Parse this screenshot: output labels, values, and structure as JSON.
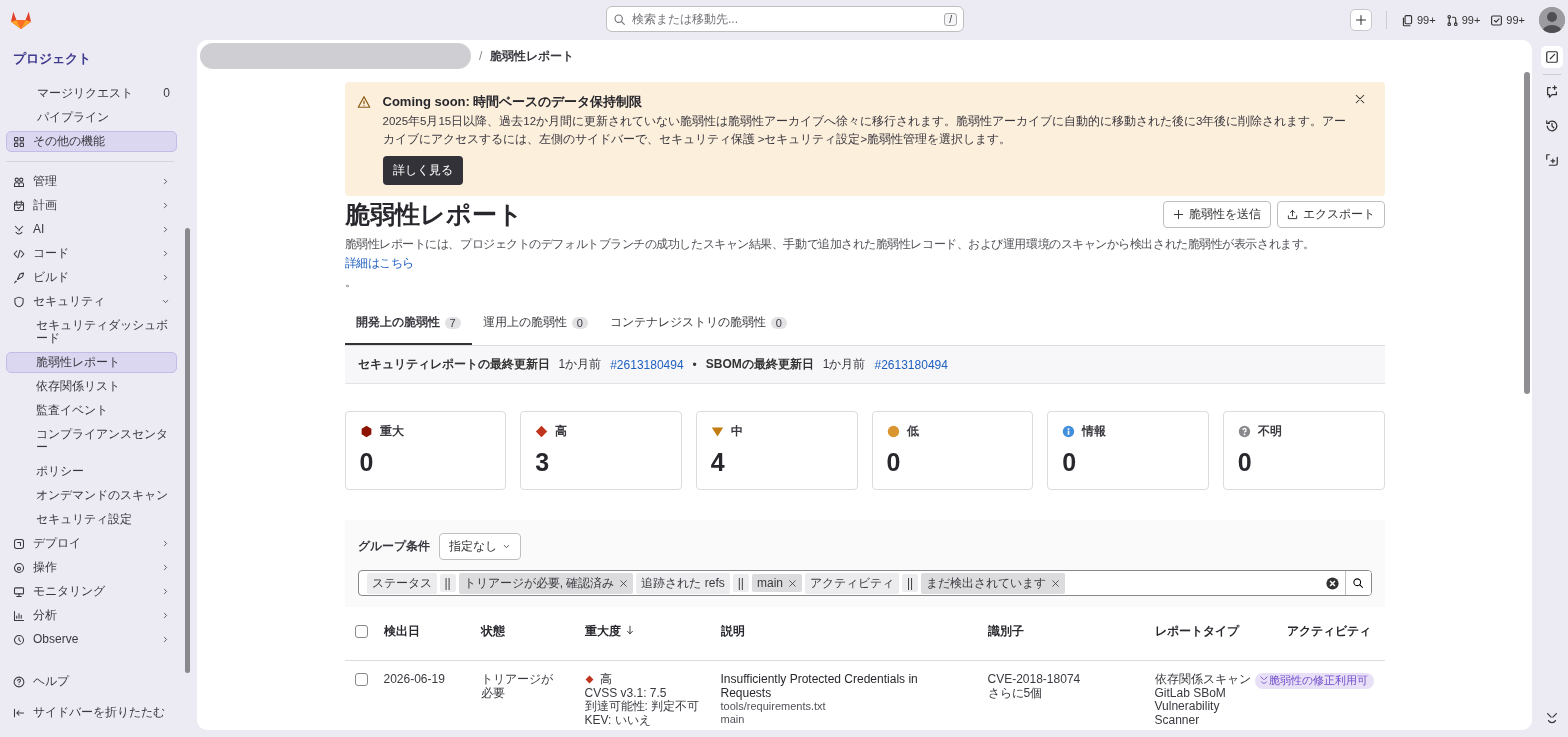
{
  "topbar": {
    "search_placeholder": "検索または移動先...",
    "shortcut": "/",
    "counters": [
      {
        "kind": "issues",
        "value": "99+"
      },
      {
        "kind": "merge-requests",
        "value": "99+"
      },
      {
        "kind": "todos",
        "value": "99+"
      }
    ]
  },
  "sidebar": {
    "title": "プロジェクト",
    "pinned": [
      {
        "label": "マージリクエスト",
        "count": "0",
        "selected": false
      },
      {
        "label": "パイプライン",
        "selected": false
      },
      {
        "label": "その他の機能",
        "selected": true
      }
    ],
    "groups": [
      {
        "label": "管理",
        "expanded": false
      },
      {
        "label": "計画",
        "expanded": false
      },
      {
        "label": "AI",
        "expanded": false
      },
      {
        "label": "コード",
        "expanded": false
      },
      {
        "label": "ビルド",
        "expanded": false
      },
      {
        "label": "セキュリティ",
        "expanded": true,
        "children": [
          {
            "label": "セキュリティダッシュボード",
            "selected": false
          },
          {
            "label": "脆弱性レポート",
            "selected": true
          },
          {
            "label": "依存関係リスト",
            "selected": false
          },
          {
            "label": "監査イベント",
            "selected": false
          },
          {
            "label": "コンプライアンスセンター",
            "selected": false
          },
          {
            "label": "ポリシー",
            "selected": false
          },
          {
            "label": "オンデマンドのスキャン",
            "selected": false
          },
          {
            "label": "セキュリティ設定",
            "selected": false
          }
        ]
      },
      {
        "label": "デプロイ",
        "expanded": false
      },
      {
        "label": "操作",
        "expanded": false
      },
      {
        "label": "モニタリング",
        "expanded": false
      },
      {
        "label": "分析",
        "expanded": false
      },
      {
        "label": "Observe",
        "expanded": false
      }
    ],
    "footer": [
      "ヘルプ",
      "サイドバーを折りたたむ"
    ]
  },
  "breadcrumb": {
    "separator": "/",
    "current": "脆弱性レポート"
  },
  "banner": {
    "title": "Coming soon: 時間ベースのデータ保持制限",
    "text": "2025年5月15日以降、過去12か月間に更新されていない脆弱性は脆弱性アーカイブへ徐々に移行されます。脆弱性アーカイブに自動的に移動された後に3年後に削除されます。アーカイブにアクセスするには、左側のサイドバーで、セキュリティ保護 >セキュリティ設定>脆弱性管理を選択します。",
    "button": "詳しく見る"
  },
  "page": {
    "title": "脆弱性レポート",
    "buttons": [
      {
        "kind": "add",
        "label": "脆弱性を送信"
      },
      {
        "kind": "export",
        "label": "エクスポート"
      }
    ],
    "description": "脆弱性レポートには、プロジェクトのデフォルトブランチの成功したスキャン結果、手動で追加された脆弱性レコード、および運用環境のスキャンから検出された脆弱性が表示されます。",
    "link": "詳細はこちら",
    "suffix": "。"
  },
  "tabs": [
    {
      "label": "開発上の脆弱性",
      "count": "7",
      "selected": true
    },
    {
      "label": "運用上の脆弱性",
      "count": "0",
      "selected": false
    },
    {
      "label": "コンテナレジストリの脆弱性",
      "count": "0",
      "selected": false
    }
  ],
  "updates": {
    "separator": "•",
    "items": [
      {
        "label": "セキュリティレポートの最終更新日",
        "time": "1か月前",
        "link": "#2613180494"
      },
      {
        "label": "SBOMの最終更新日",
        "time": "1か月前",
        "link": "#2613180494"
      }
    ]
  },
  "severity_cards": [
    {
      "kind": "critical",
      "label": "重大",
      "count": "0",
      "color": "#8d1300"
    },
    {
      "kind": "high",
      "label": "高",
      "count": "3",
      "color": "#c0341d"
    },
    {
      "kind": "medium",
      "label": "中",
      "count": "4",
      "color": "#c17d10"
    },
    {
      "kind": "low",
      "label": "低",
      "count": "0",
      "color": "#d99530"
    },
    {
      "kind": "info",
      "label": "情報",
      "count": "0",
      "color": "#428fdc"
    },
    {
      "kind": "unknown",
      "label": "不明",
      "count": "0",
      "color": "#89888d"
    }
  ],
  "grouping": {
    "label": "グループ条件",
    "value": "指定なし"
  },
  "filters": [
    {
      "name": "ステータス",
      "operator": "||",
      "value": "トリアージが必要, 確認済み"
    },
    {
      "name": "追跡された refs",
      "operator": "||",
      "value": "main"
    },
    {
      "name": "アクティビティ",
      "operator": "||",
      "value": "まだ検出されています"
    }
  ],
  "table": {
    "select_all": false,
    "columns": [
      {
        "label": "検出日",
        "sorted": false
      },
      {
        "label": "状態",
        "sorted": false
      },
      {
        "label": "重大度",
        "sorted": true
      },
      {
        "label": "説明",
        "sorted": false
      },
      {
        "label": "識別子",
        "sorted": false
      },
      {
        "label": "レポートタイプ",
        "sorted": false
      },
      {
        "label": "アクティビティ",
        "sorted": false
      }
    ],
    "rows": [
      {
        "checked": false,
        "date": "2026-06-19",
        "status": "トリアージが必要",
        "severity": {
          "kind": "high",
          "label": "高",
          "color": "#c0341d",
          "details": [
            "CVSS v3.1: 7.5",
            "到達可能性: 判定不可",
            "KEV: いいえ"
          ]
        },
        "title": "Insufficiently Protected Credentials in Requests",
        "file": "tools/requirements.txt",
        "ref": "main",
        "identifier": "CVE-2018-18074",
        "more": "さらに5個",
        "report_types": [
          "依存関係スキャン",
          "GitLab SBoM Vulnerability Scanner"
        ],
        "activity": "脆弱性の修正利用可"
      }
    ]
  }
}
